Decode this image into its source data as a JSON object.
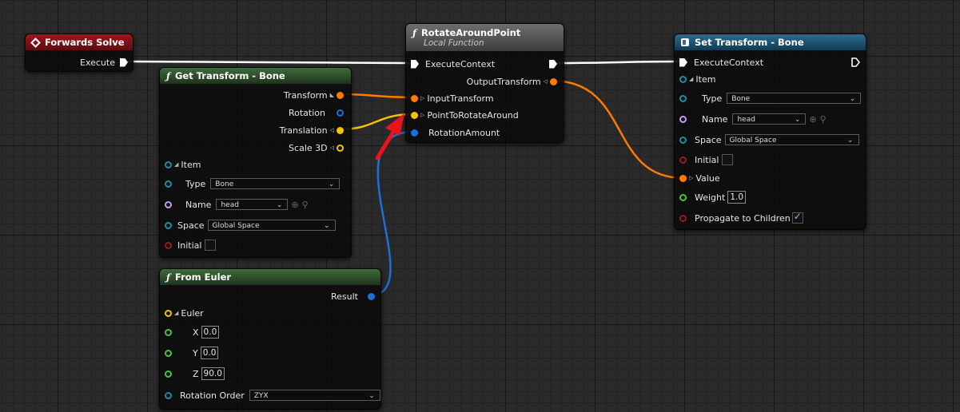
{
  "colors": {
    "exec": "#ffffff",
    "transform": "#ff7a00",
    "vector": "#f5c400",
    "rotation": "#1e6fd9",
    "name": "#c79bff",
    "struct": "#1c8fa3",
    "bool": "#9a1a1a",
    "float": "#46c83a",
    "annotation_arrow": "#e8151b"
  },
  "forwards_solve": {
    "title": "Forwards Solve",
    "execute_label": "Execute"
  },
  "get_transform": {
    "title": "Get Transform - Bone",
    "outputs": {
      "transform": "Transform",
      "rotation": "Rotation",
      "translation": "Translation",
      "scale": "Scale 3D"
    },
    "item_label": "Item",
    "type_label": "Type",
    "type_value": "Bone",
    "name_label": "Name",
    "name_value": "head",
    "space_label": "Space",
    "space_value": "Global Space",
    "initial_label": "Initial"
  },
  "rotate_around_point": {
    "title": "RotateAroundPoint",
    "subtitle": "Local Function",
    "execute_label": "ExecuteContext",
    "output_label": "OutputTransform",
    "input_transform_label": "InputTransform",
    "point_label": "PointToRotateAround",
    "rotation_amount_label": "RotationAmount"
  },
  "set_transform": {
    "title": "Set Transform - Bone",
    "execute_label": "ExecuteContext",
    "item_label": "Item",
    "type_label": "Type",
    "type_value": "Bone",
    "name_label": "Name",
    "name_value": "head",
    "space_label": "Space",
    "space_value": "Global Space",
    "initial_label": "Initial",
    "value_label": "Value",
    "weight_label": "Weight",
    "weight_value": "1.0",
    "propagate_label": "Propagate to Children"
  },
  "from_euler": {
    "title": "From Euler",
    "result_label": "Result",
    "euler_label": "Euler",
    "x_label": "X",
    "x_value": "0.0",
    "y_label": "Y",
    "y_value": "0.0",
    "z_label": "Z",
    "z_value": "90.0",
    "rotation_order_label": "Rotation Order",
    "rotation_order_value": "ZYX"
  },
  "icons": {
    "function": "ƒ",
    "event": "diamond-event-icon",
    "set_node": "set-node-icon"
  }
}
